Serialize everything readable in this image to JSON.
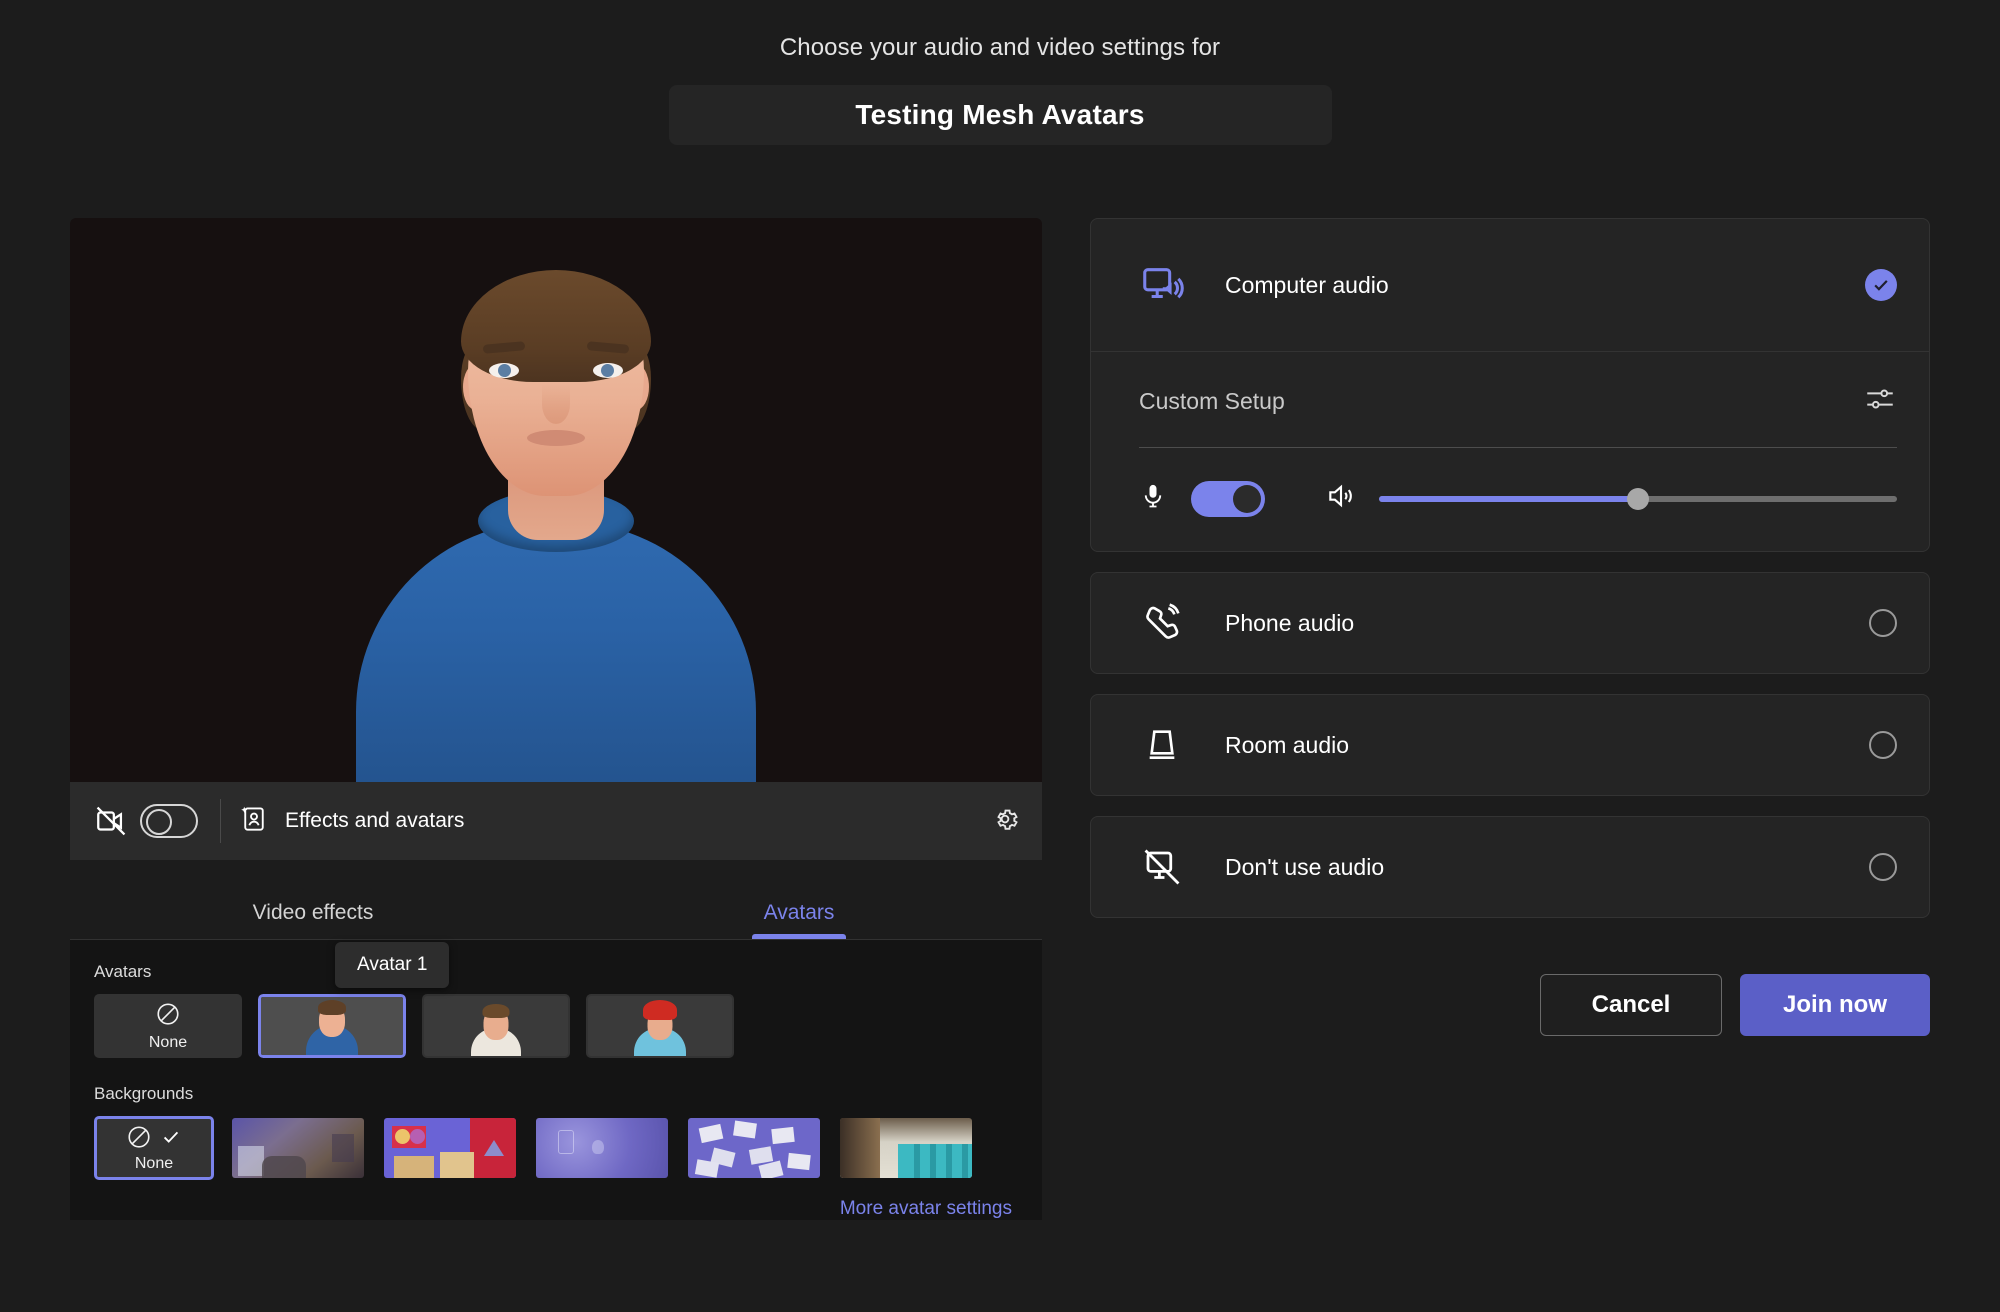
{
  "header": {
    "subtitle": "Choose your audio and video settings for",
    "meeting_title": "Testing Mesh Avatars"
  },
  "video": {
    "toolbar": {
      "camera_icon": "camera-off-icon",
      "camera_toggle_state": "off",
      "effects_label": "Effects and avatars",
      "effects_icon": "effects-avatar-icon",
      "settings_icon": "gear-icon"
    },
    "tabs": [
      {
        "label": "Video effects",
        "active": false
      },
      {
        "label": "Avatars",
        "active": true
      }
    ],
    "avatars_section": {
      "label": "Avatars",
      "tooltip": "Avatar 1",
      "items": [
        {
          "label": "None",
          "type": "none",
          "selected": false
        },
        {
          "label": "Avatar 1",
          "type": "avatar",
          "selected": true
        },
        {
          "label": "Avatar 2",
          "type": "avatar",
          "selected": false
        },
        {
          "label": "Avatar 3",
          "type": "avatar",
          "selected": false
        }
      ]
    },
    "backgrounds_section": {
      "label": "Backgrounds",
      "items": [
        {
          "label": "None",
          "type": "none",
          "selected": true
        },
        {
          "label": "Living room",
          "type": "image",
          "selected": false
        },
        {
          "label": "Colorful studio",
          "type": "image",
          "selected": false
        },
        {
          "label": "Purple blur",
          "type": "image",
          "selected": false
        },
        {
          "label": "Photo wall",
          "type": "image",
          "selected": false
        },
        {
          "label": "Lockers hallway",
          "type": "image",
          "selected": false
        }
      ]
    },
    "more_settings_link": "More avatar settings"
  },
  "audio": {
    "options": [
      {
        "label": "Computer audio",
        "icon": "computer-audio-icon",
        "selected": true
      },
      {
        "label": "Phone audio",
        "icon": "phone-audio-icon",
        "selected": false
      },
      {
        "label": "Room audio",
        "icon": "room-audio-icon",
        "selected": false
      },
      {
        "label": "Don't use audio",
        "icon": "no-audio-icon",
        "selected": false
      }
    ],
    "custom_setup": {
      "title": "Custom Setup",
      "tune_icon": "tune-sliders-icon",
      "mic_icon": "microphone-icon",
      "mic_enabled": true,
      "speaker_icon": "speaker-icon",
      "volume_percent": 50
    }
  },
  "actions": {
    "cancel_label": "Cancel",
    "join_label": "Join now"
  },
  "colors": {
    "accent": "#7b83eb",
    "join_button": "#5b5fc7",
    "page_bg": "#1c1c1c",
    "card_bg": "#242424",
    "preview_bg": "#161010"
  }
}
